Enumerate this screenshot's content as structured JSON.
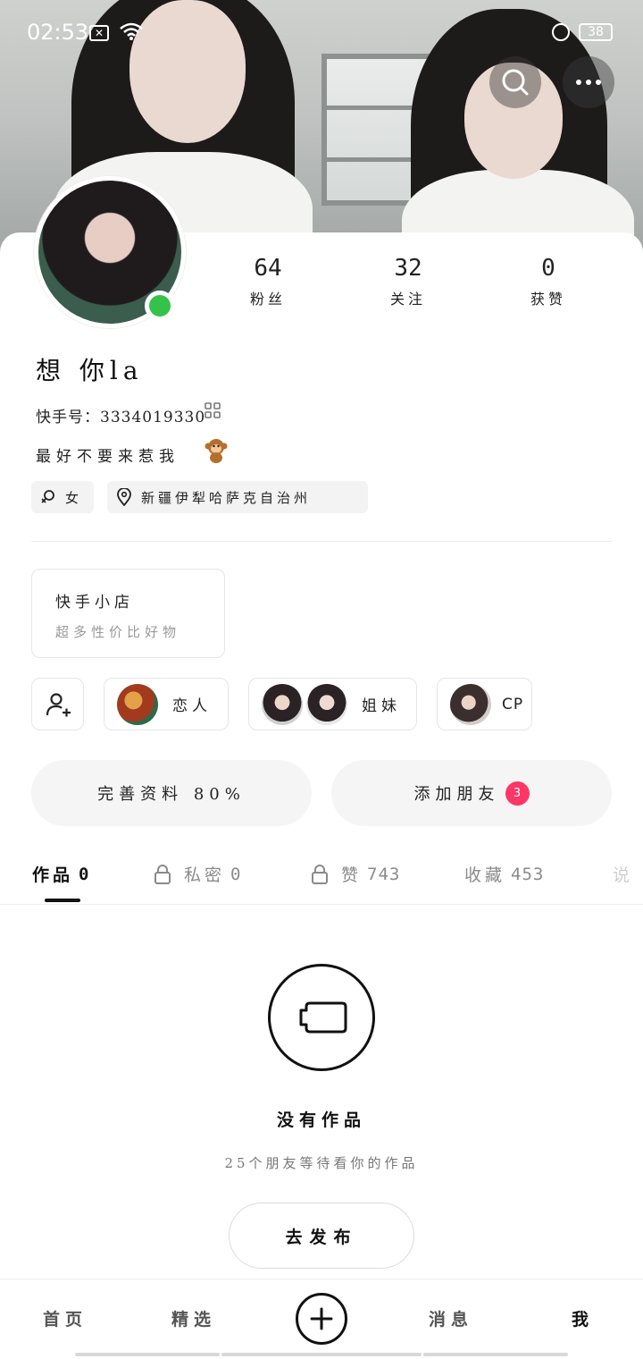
{
  "status_bar": {
    "time": "02:53",
    "battery": "38"
  },
  "header": {
    "search_icon": "search-icon",
    "more_icon": "more-horizontal-icon"
  },
  "profile": {
    "name": "想 你la",
    "kuaishou_id": "快手号：3334019330",
    "bio": "最好不要来惹我",
    "gender": "女",
    "location": "新疆伊犁哈萨克自治州",
    "online": true
  },
  "stats": [
    {
      "value": "64",
      "label": "粉丝"
    },
    {
      "value": "32",
      "label": "关注"
    },
    {
      "value": "0",
      "label": "获赞"
    }
  ],
  "shop": {
    "title": "快手小店",
    "subtitle": "超多性价比好物"
  },
  "relations": {
    "lovers": "恋人",
    "sisters": "姐妹",
    "cp": "CP"
  },
  "actions": {
    "complete_profile": "完善资料 80%",
    "add_friends": "添加朋友",
    "add_friends_badge": "3"
  },
  "tabs": [
    {
      "label": "作品",
      "count": "0"
    },
    {
      "label": "私密",
      "count": "0"
    },
    {
      "label": "赞",
      "count": "743"
    },
    {
      "label": "收藏",
      "count": "453"
    },
    {
      "label": "说",
      "count": ""
    }
  ],
  "empty_state": {
    "title": "没有作品",
    "subtitle": "25个朋友等待看你的作品",
    "button": "去发布"
  },
  "bottom_nav": {
    "home": "首页",
    "featured": "精选",
    "messages": "消息",
    "me": "我"
  },
  "colors": {
    "online": "#35c24a",
    "badge": "#fe3666"
  }
}
